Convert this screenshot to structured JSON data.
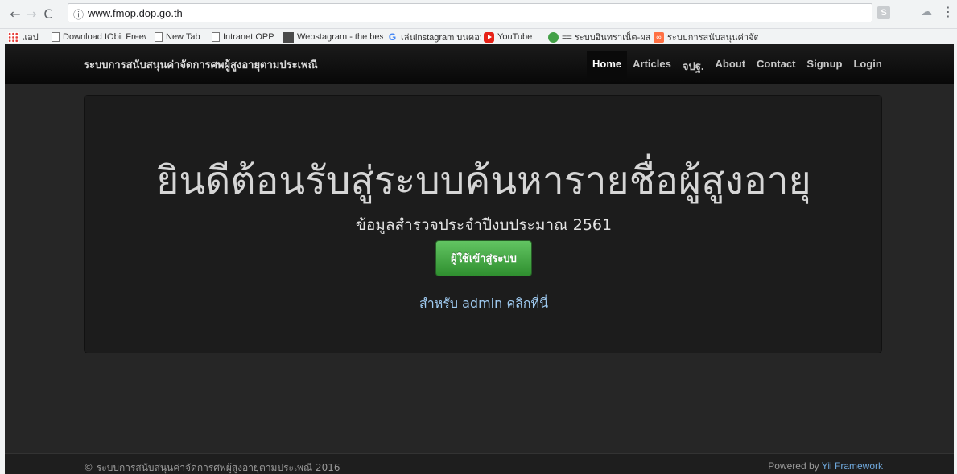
{
  "browser": {
    "url": "www.fmop.dop.go.th",
    "ext_label": "S",
    "bookmarks": [
      {
        "label": "แอป",
        "icon": "apps-icon"
      },
      {
        "label": "Download IObit Freew",
        "icon": "page-icon"
      },
      {
        "label": "New Tab",
        "icon": "page-icon"
      },
      {
        "label": "Intranet OPP",
        "icon": "page-icon"
      },
      {
        "label": "Webstagram - the bes",
        "icon": "webstagram-icon"
      },
      {
        "label": "เล่นinstagram บนคอม -",
        "icon": "google-icon"
      },
      {
        "label": "YouTube",
        "icon": "youtube-icon"
      },
      {
        "label": "== ระบบอินทราเน็ต-ผส.",
        "icon": "tree-icon"
      },
      {
        "label": "ระบบการสนับสนุนค่าจัดก",
        "icon": "oo-icon"
      }
    ]
  },
  "navbar": {
    "brand": "ระบบการสนับสนุนค่าจัดการศพผู้สูงอายุตามประเพณี",
    "links": [
      "Home",
      "Articles",
      "จปฐ.",
      "About",
      "Contact",
      "Signup",
      "Login"
    ]
  },
  "hero": {
    "title": "ยินดีต้อนรับสู่ระบบค้นหารายชื่อผู้สูงอายุ",
    "subtitle": "ข้อมูลสำรวจประจำปีงบประมาณ 2561",
    "login_button": "ผู้ใช้เข้าสู่ระบบ",
    "admin_link": "สำหรับ admin คลิกที่นี่"
  },
  "footer": {
    "copyright": "© ระบบการสนับสนุนค่าจัดการศพผู้สูงอายุตามประเพณี 2016",
    "powered_prefix": "Powered by",
    "powered_link": "Yii Framework"
  },
  "colors": {
    "page_bg": "#262626",
    "hero_bg": "#1c1c1c",
    "button_green": "#51a351",
    "link_blue": "#9ec9ef"
  }
}
